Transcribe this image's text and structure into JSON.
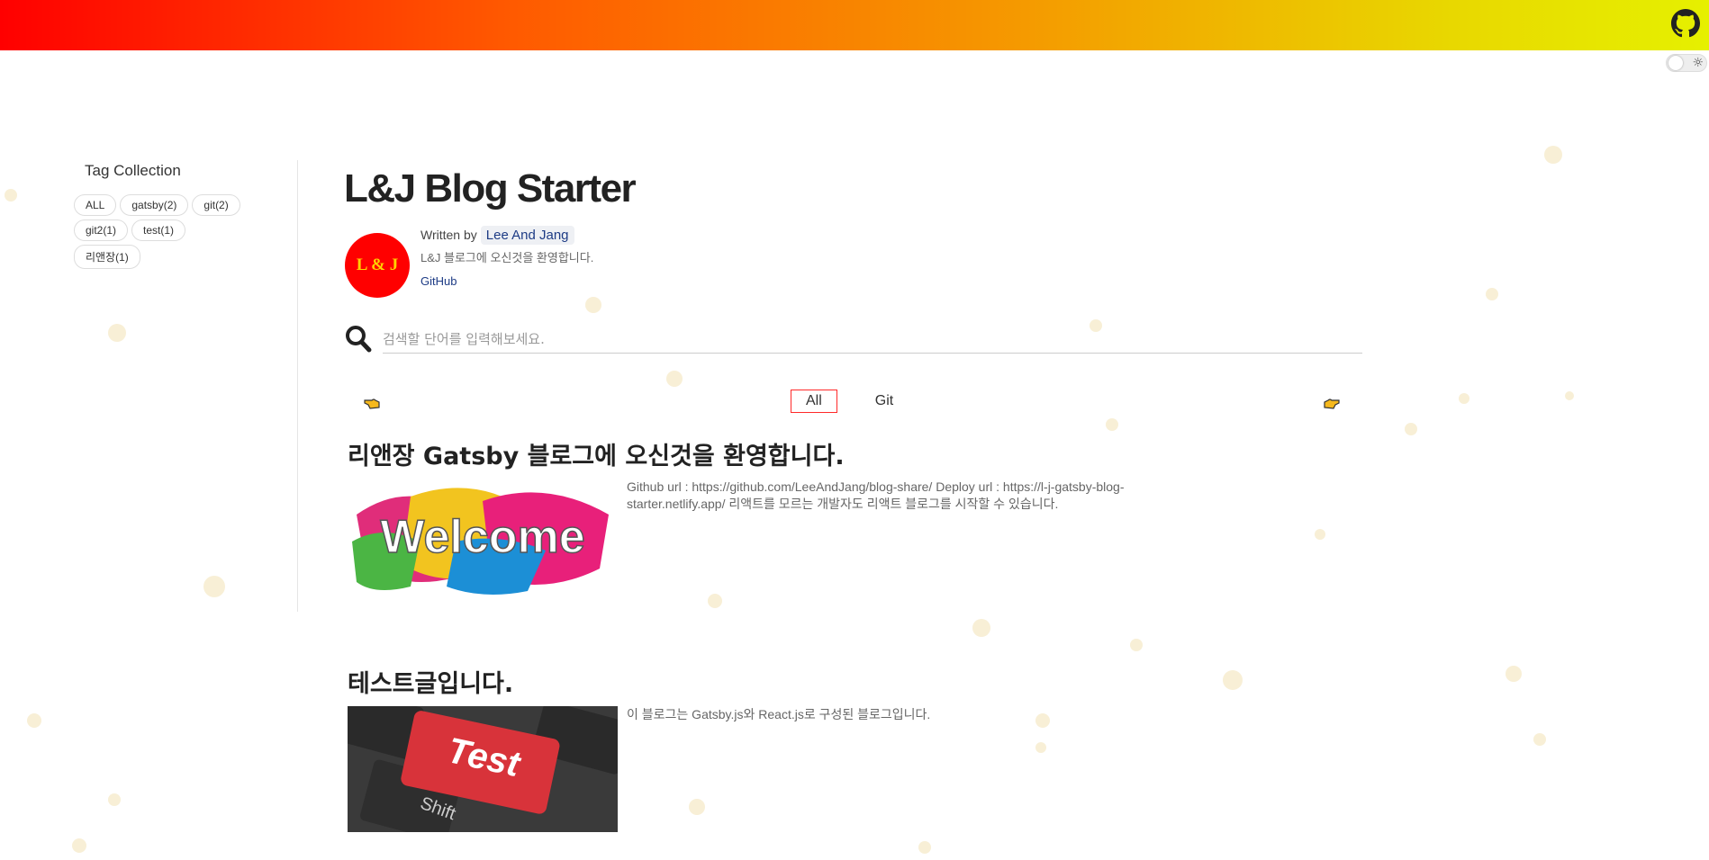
{
  "header": {
    "github_icon": "github-icon",
    "theme_toggle_icon": "sun-icon",
    "accent": "#ff0000"
  },
  "sidebar": {
    "title": "Tag Collection",
    "tags": [
      "ALL",
      "gatsby(2)",
      "git(2)",
      "git2(1)",
      "test(1)",
      "리앤장(1)"
    ]
  },
  "blog": {
    "title": "L&J Blog Starter",
    "avatar_text": "L & J",
    "written_by": "Written by",
    "author": "Lee And Jang",
    "description": "L&J 블로그에 오신것을 환영합니다.",
    "github_label": "GitHub"
  },
  "search": {
    "placeholder": "검색할 단어를 입력해보세요.",
    "value": ""
  },
  "categories": {
    "items": [
      "All",
      "Git"
    ],
    "selected": "All"
  },
  "posts": [
    {
      "title": "리앤장 Gatsby 블로그에 오신것을 환영합니다.",
      "excerpt": "Github url : https://github.com/LeeAndJang/blog-share/ Deploy url : https://l-j-gatsby-blog-starter.netlify.app/ 리액트를 모르는 개발자도 리액트 블로그를 시작할 수 있습니다.",
      "thumbnail_text": "Welcome"
    },
    {
      "title": "테스트글입니다.",
      "excerpt": "이 블로그는 Gatsby.js와 React.js로 구성된 블로그입니다.",
      "thumbnail_text": "Test",
      "thumbnail_key_label": "Shift"
    }
  ]
}
